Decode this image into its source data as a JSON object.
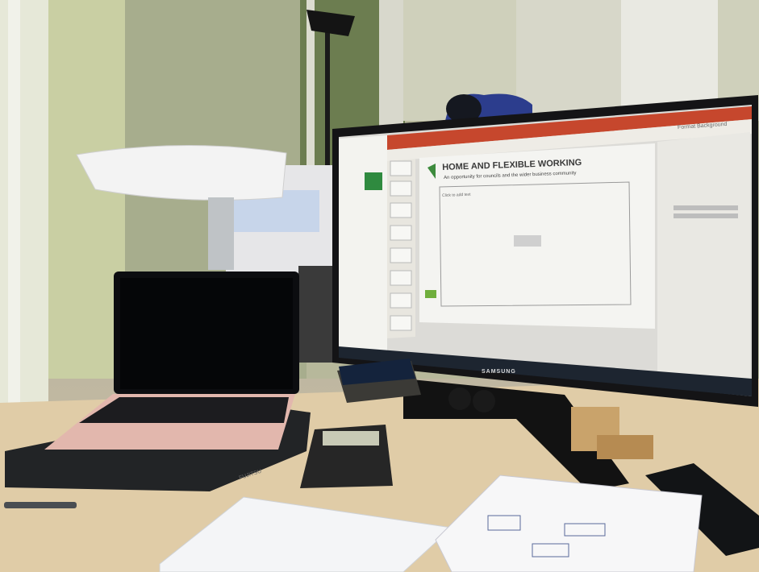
{
  "monitor": {
    "slide_title": "HOME AND FLEXIBLE WORKING",
    "slide_subtitle": "An opportunity for councils and the wider business community",
    "slide_placeholder": "Click to add text",
    "brand": "SAMSUNG",
    "pane_title": "Format Background"
  },
  "laptop_base": {
    "brand": "FUJITSU"
  }
}
